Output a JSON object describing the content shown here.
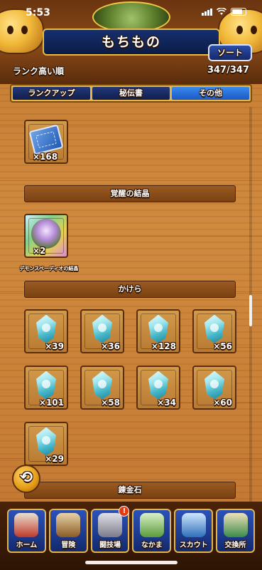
{
  "status_bar": {
    "time": "5:53"
  },
  "header": {
    "title": "もちもの",
    "sort_label": "ソート",
    "sort_order": "ランク高い順",
    "count": "347/347"
  },
  "tabs": [
    {
      "label": "ランクアップ",
      "active": false
    },
    {
      "label": "秘伝書",
      "active": false
    },
    {
      "label": "その他",
      "active": true
    }
  ],
  "items_top": [
    {
      "icon": "ticket-icon",
      "qty": "×168"
    }
  ],
  "sections": [
    {
      "title": "覚醒の結晶",
      "items": [
        {
          "icon": "awakening-crystal-icon",
          "qty": "×2",
          "name": "デモンスペーディオの結晶"
        }
      ]
    },
    {
      "title": "かけら",
      "items": [
        {
          "icon": "crystal-shard-icon",
          "qty": "×39"
        },
        {
          "icon": "crystal-shard-icon",
          "qty": "×36"
        },
        {
          "icon": "crystal-shard-icon",
          "qty": "×128"
        },
        {
          "icon": "crystal-shard-icon",
          "qty": "×56"
        },
        {
          "icon": "crystal-shard-icon",
          "qty": "×101"
        },
        {
          "icon": "crystal-shard-icon",
          "qty": "×58"
        },
        {
          "icon": "crystal-shard-icon",
          "qty": "×34"
        },
        {
          "icon": "crystal-shard-icon",
          "qty": "×60"
        },
        {
          "icon": "crystal-shard-icon",
          "qty": "×29"
        }
      ]
    },
    {
      "title": "錬金石",
      "items": []
    }
  ],
  "bottom_nav": [
    {
      "label": "ホーム",
      "icon": "home-tent-icon",
      "color": "#c0392b"
    },
    {
      "label": "冒険",
      "icon": "adventure-wagon-icon",
      "color": "#b07a3a"
    },
    {
      "label": "闘技場",
      "icon": "arena-castle-icon",
      "color": "#8a8a9a",
      "badge": "!"
    },
    {
      "label": "なかま",
      "icon": "monster-friend-icon",
      "color": "#6aa84f"
    },
    {
      "label": "スカウト",
      "icon": "scout-icon",
      "color": "#3d85c6"
    },
    {
      "label": "交換所",
      "icon": "exchange-dragon-icon",
      "color": "#d27a2a"
    }
  ],
  "colors": {
    "accent_gold": "#e5b444",
    "tab_active": "#2f7ae8",
    "nav_blue": "#1d3f96"
  }
}
